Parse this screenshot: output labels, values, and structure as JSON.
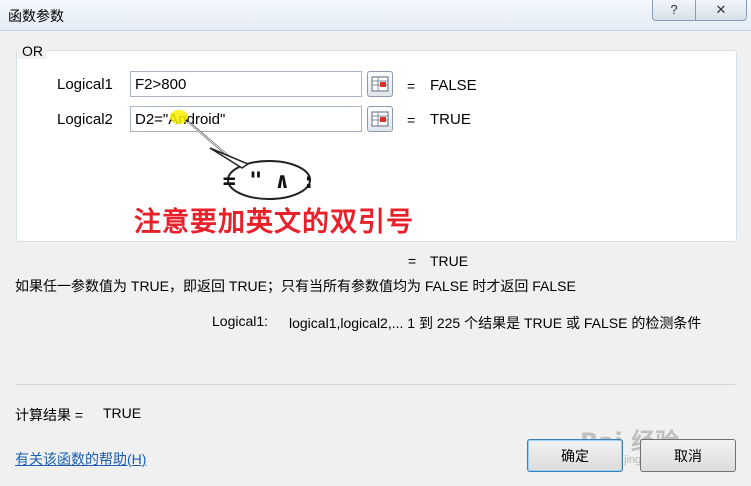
{
  "window": {
    "title": "函数参数",
    "help_glyph": "?",
    "close_glyph": "✕"
  },
  "function": {
    "name": "OR"
  },
  "args": [
    {
      "label": "Logical1",
      "value": "F2>800",
      "eq": "=",
      "result": "FALSE"
    },
    {
      "label": "Logical2",
      "value": "D2=\"Android\"",
      "eq": "=",
      "result": "TRUE"
    }
  ],
  "annotation": {
    "bubble_text": "= \" ∧ :",
    "note": "注意要加英文的双引号",
    "note_color": "#e8202a",
    "highlight_color": "#f7f000"
  },
  "formula_result": {
    "eq": "=",
    "value": "TRUE"
  },
  "description": "如果任一参数值为 TRUE，即返回 TRUE；只有当所有参数值均为 FALSE 时才返回 FALSE",
  "arg_help": {
    "name": "Logical1:",
    "text": "logical1,logical2,... 1 到 225 个结果是 TRUE 或 FALSE 的检测条件"
  },
  "calc": {
    "label": "计算结果 =",
    "value": "TRUE"
  },
  "help_link": "有关该函数的帮助(H)",
  "buttons": {
    "ok": "确定",
    "cancel": "取消"
  },
  "watermark": {
    "main": "Bai 经验",
    "sub": "jingyan.baidu.com"
  }
}
